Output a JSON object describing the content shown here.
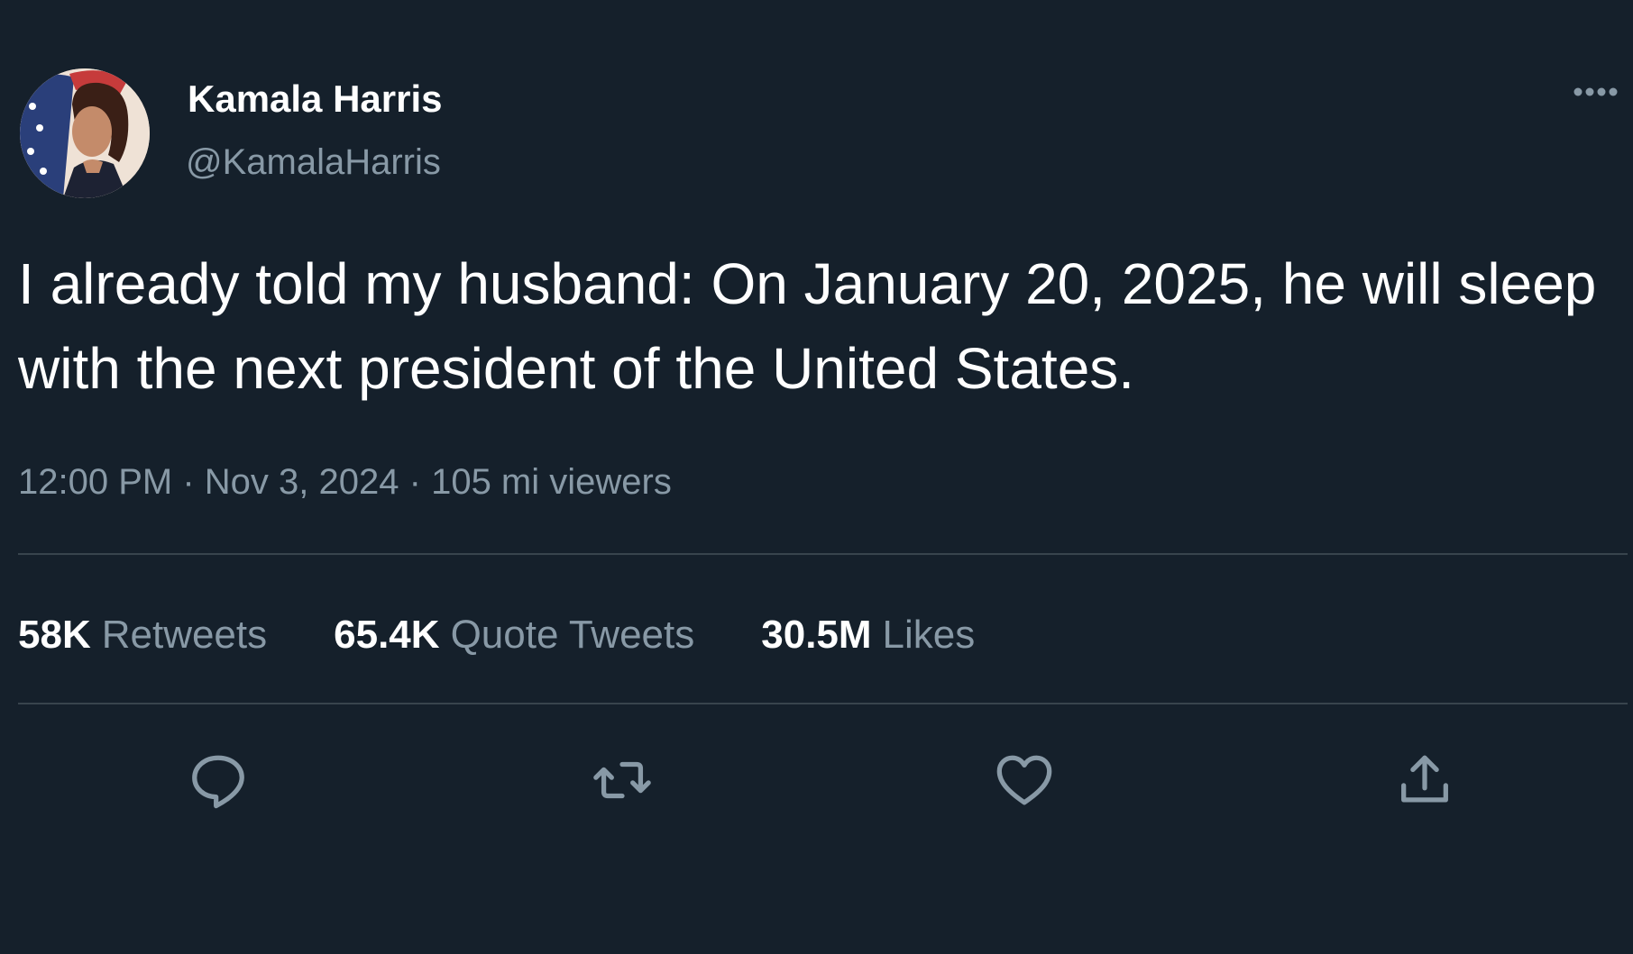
{
  "author": {
    "display_name": "Kamala Harris",
    "handle": "@KamalaHarris"
  },
  "tweet": {
    "text": "I already told my husband: On January 20, 2025, he will sleep with the next president of the United States.",
    "time": "12:00 PM",
    "separator": "·",
    "date": "Nov 3, 2024",
    "views": "105 mi viewers"
  },
  "stats": {
    "retweets": {
      "count": "58K",
      "label": "Retweets"
    },
    "quote_tweets": {
      "count": "65.4K",
      "label": "Quote Tweets"
    },
    "likes": {
      "count": "30.5M",
      "label": "Likes"
    }
  },
  "actions": [
    "reply-icon",
    "retweet-icon",
    "like-icon",
    "share-icon"
  ],
  "colors": {
    "background": "#15202b",
    "primary_text": "#ffffff",
    "secondary_text": "#8899a6",
    "divider": "#38444d"
  }
}
